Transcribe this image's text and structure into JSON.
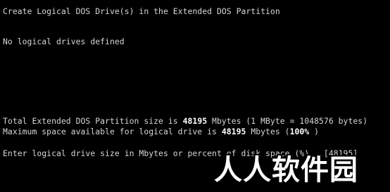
{
  "screen": {
    "title": "Create Logical DOS Drive(s) in the Extended DOS Partition",
    "status": "No logical drives defined",
    "total_line": {
      "label_before": "Total Extended DOS Partition size is ",
      "size": "48195",
      "label_after": " Mbytes (1 MByte = 1048576 bytes)"
    },
    "max_line": {
      "label_before": "Maximum space available for logical drive is ",
      "size": "48195",
      "label_mid": " Mbytes (",
      "percent": "100%",
      "label_after": " )"
    },
    "prompt": {
      "text": "Enter logical drive size in Mbytes or percent of disk space (%)...",
      "default_value": "[48195]"
    }
  },
  "watermark": {
    "text": "人人软件园"
  },
  "colors": {
    "background": "#000000",
    "text": "#d6d6d6",
    "highlight": "#ffffff"
  }
}
